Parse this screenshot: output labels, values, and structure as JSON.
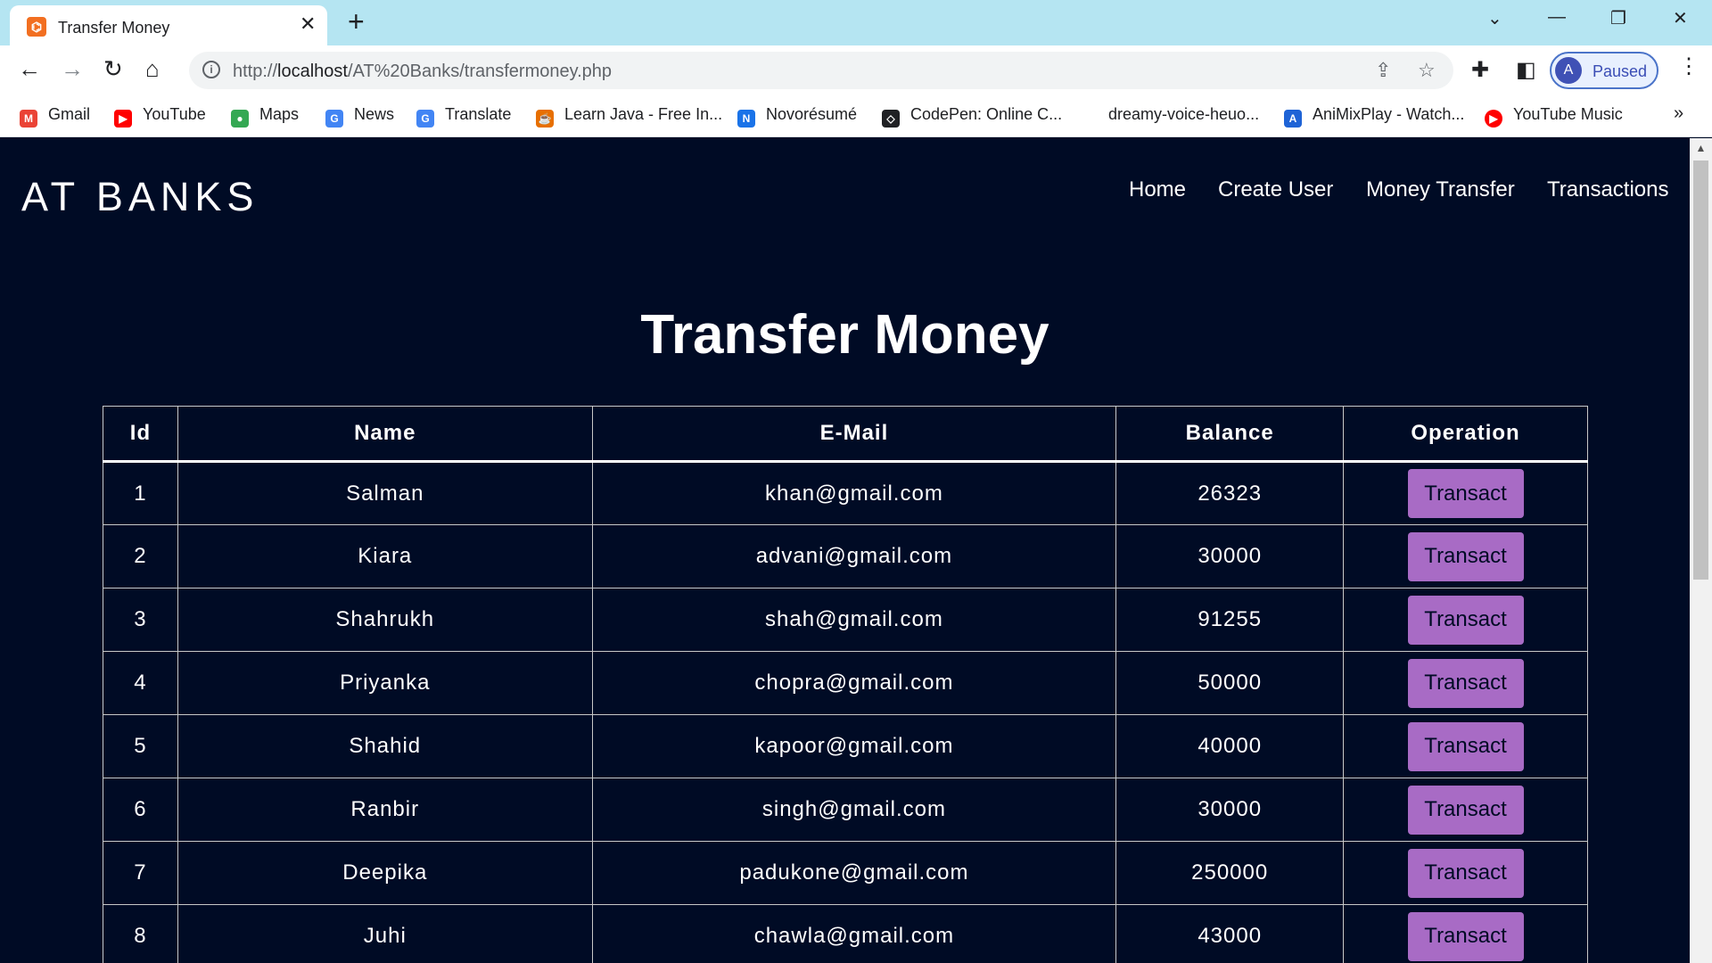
{
  "browser": {
    "tab_title": "Transfer Money",
    "favicon_glyph": "⌬",
    "url_prefix": "http://",
    "url_host": "localhost",
    "url_path": "/AT%20Banks/transfermoney.php",
    "profile_initial": "A",
    "profile_label": "Paused",
    "bookmarks": [
      {
        "label": "Gmail",
        "icon": "gmail-icon",
        "glyph": "M",
        "color": "#ea4335"
      },
      {
        "label": "YouTube",
        "icon": "youtube-icon",
        "glyph": "▶",
        "color": "#ff0000"
      },
      {
        "label": "Maps",
        "icon": "maps-icon",
        "glyph": "●",
        "color": "#34a853"
      },
      {
        "label": "News",
        "icon": "news-icon",
        "glyph": "G",
        "color": "#4285f4"
      },
      {
        "label": "Translate",
        "icon": "translate-icon",
        "glyph": "G",
        "color": "#4285f4"
      },
      {
        "label": "Learn Java - Free In...",
        "icon": "java-icon",
        "glyph": "☕",
        "color": "#e76f00"
      },
      {
        "label": "Novorésumé",
        "icon": "novoresume-icon",
        "glyph": "N",
        "color": "#1a73e8"
      },
      {
        "label": "CodePen: Online C...",
        "icon": "codepen-icon",
        "glyph": "◇",
        "color": "#202124"
      },
      {
        "label": "dreamy-voice-heuo...",
        "icon": "",
        "glyph": "",
        "color": ""
      },
      {
        "label": "AniMixPlay - Watch...",
        "icon": "animixplay-icon",
        "glyph": "A",
        "color": "#1e63d6"
      },
      {
        "label": "YouTube Music",
        "icon": "youtube-music-icon",
        "glyph": "▶",
        "color": "#ff0000"
      }
    ]
  },
  "site": {
    "brand": "AT BANKS",
    "nav": [
      "Home",
      "Create User",
      "Money Transfer",
      "Transactions"
    ]
  },
  "page": {
    "title": "Transfer Money",
    "columns": [
      "Id",
      "Name",
      "E-Mail",
      "Balance",
      "Operation"
    ],
    "button_label": "Transact",
    "rows": [
      {
        "id": "1",
        "name": "Salman",
        "email": "khan@gmail.com",
        "balance": "26323"
      },
      {
        "id": "2",
        "name": "Kiara",
        "email": "advani@gmail.com",
        "balance": "30000"
      },
      {
        "id": "3",
        "name": "Shahrukh",
        "email": "shah@gmail.com",
        "balance": "91255"
      },
      {
        "id": "4",
        "name": "Priyanka",
        "email": "chopra@gmail.com",
        "balance": "50000"
      },
      {
        "id": "5",
        "name": "Shahid",
        "email": "kapoor@gmail.com",
        "balance": "40000"
      },
      {
        "id": "6",
        "name": "Ranbir",
        "email": "singh@gmail.com",
        "balance": "30000"
      },
      {
        "id": "7",
        "name": "Deepika",
        "email": "padukone@gmail.com",
        "balance": "250000"
      },
      {
        "id": "8",
        "name": "Juhi",
        "email": "chawla@gmail.com",
        "balance": "43000"
      }
    ]
  },
  "colors": {
    "page_background": "#000b25",
    "button_background": "#a86bc5",
    "tabbar_background": "#b5e5f2"
  }
}
